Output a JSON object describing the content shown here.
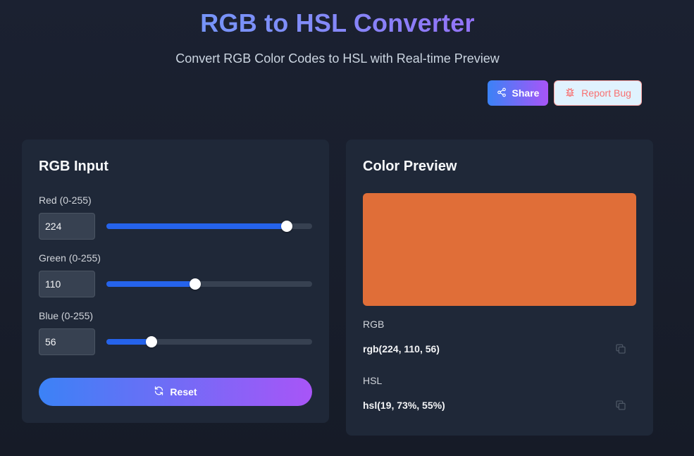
{
  "header": {
    "title": "RGB to HSL Converter",
    "subtitle": "Convert RGB Color Codes to HSL with Real-time Preview",
    "share_label": "Share",
    "report_bug_label": "Report Bug"
  },
  "input_panel": {
    "title": "RGB Input",
    "channels": [
      {
        "label": "Red (0-255)",
        "value": "224",
        "fraction": 0.878
      },
      {
        "label": "Green (0-255)",
        "value": "110",
        "fraction": 0.431
      },
      {
        "label": "Blue (0-255)",
        "value": "56",
        "fraction": 0.22
      }
    ],
    "reset_label": "Reset"
  },
  "preview_panel": {
    "title": "Color Preview",
    "swatch_color": "#e06e38",
    "rgb_label": "RGB",
    "rgb_value": "rgb(224, 110, 56)",
    "hsl_label": "HSL",
    "hsl_value": "hsl(19, 73%, 55%)"
  },
  "icons": {
    "share": "share-icon",
    "bug": "bug-icon",
    "reset": "refresh-icon",
    "copy": "copy-icon"
  },
  "colors": {
    "accent_start": "#3b82f6",
    "accent_end": "#a855f7",
    "slider_fill": "#2563eb"
  }
}
